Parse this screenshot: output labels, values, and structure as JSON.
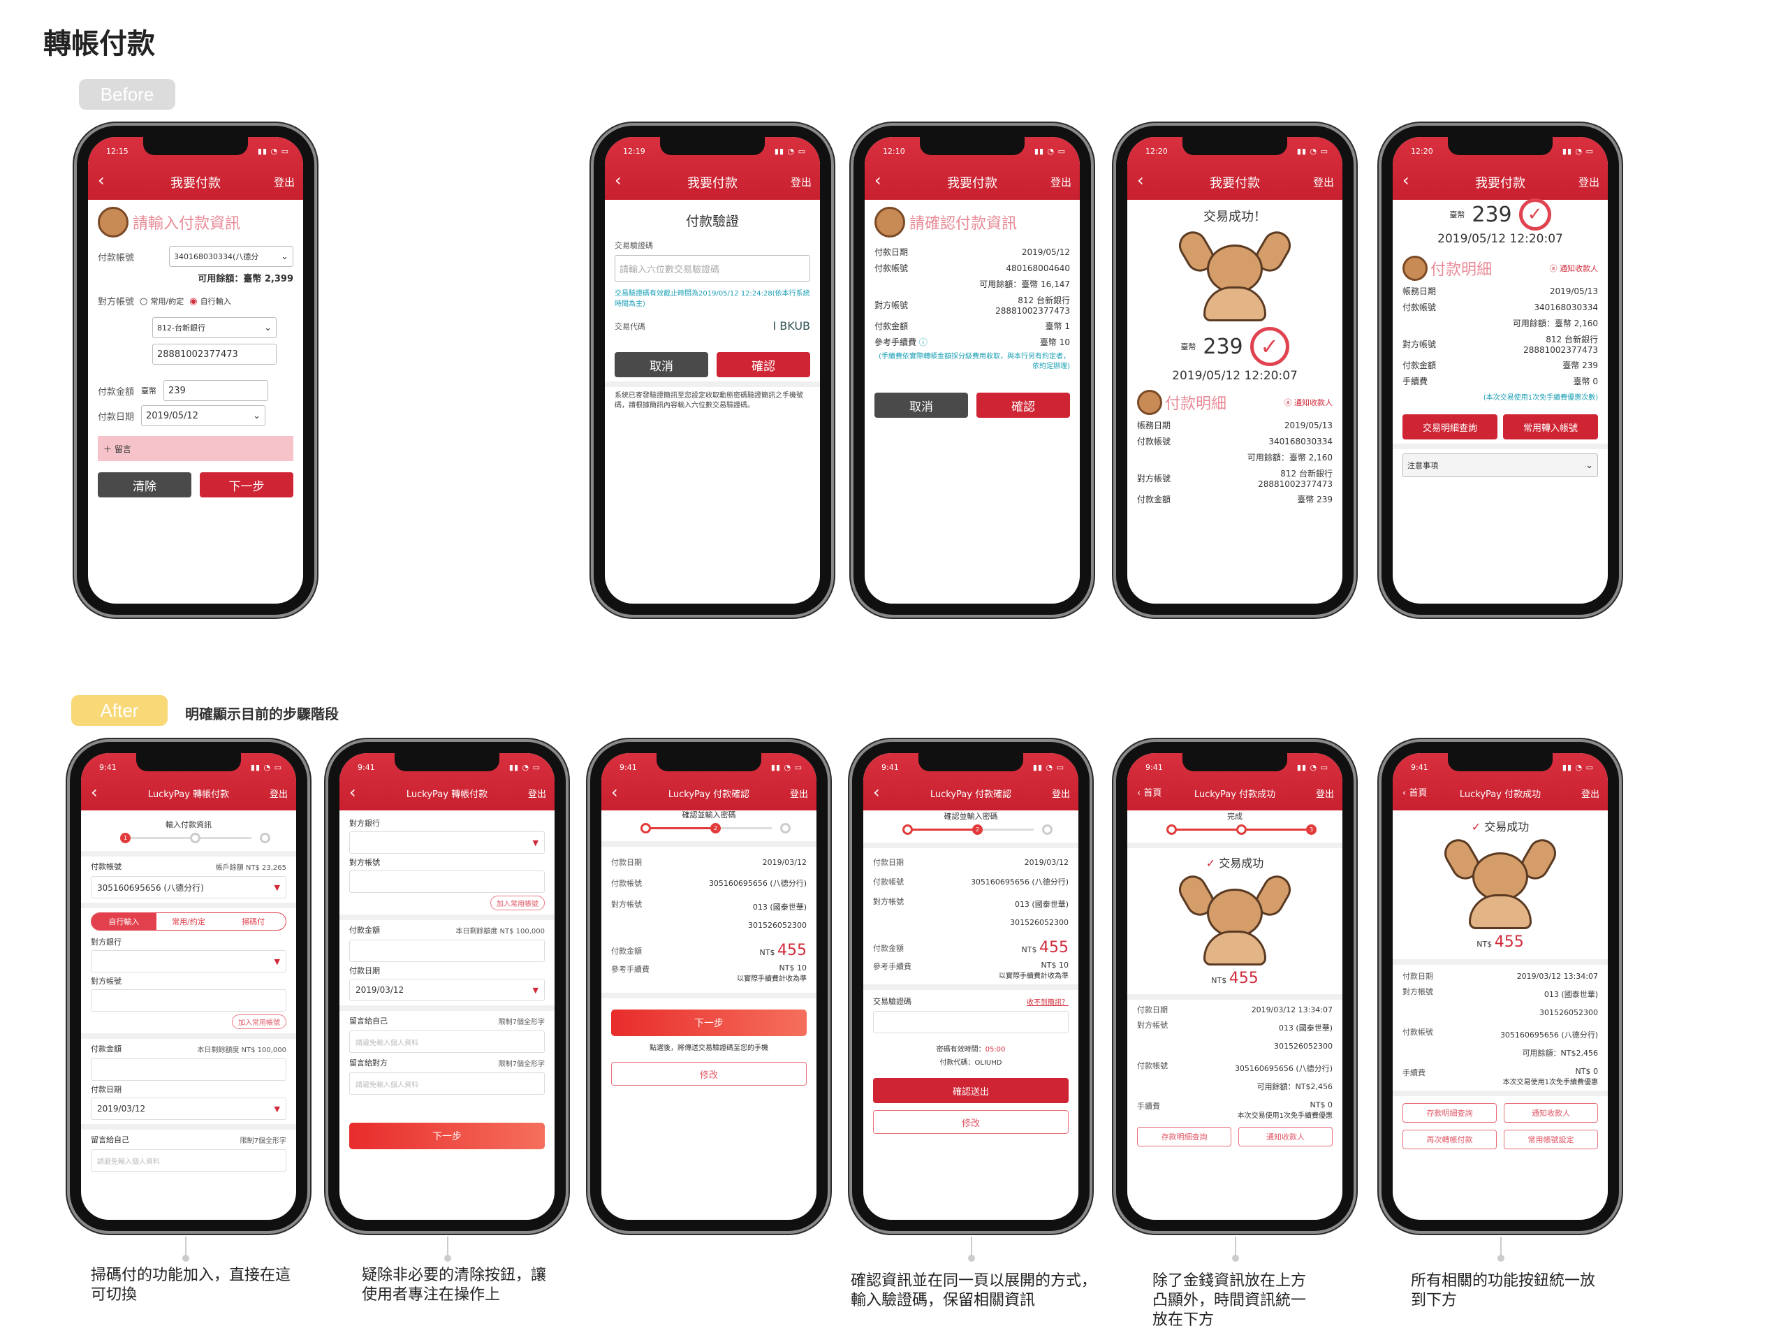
{
  "heading": "轉帳付款",
  "labels": {
    "before": "Before",
    "after": "After",
    "after_note": "明確顯示目前的步驟階段"
  },
  "before": {
    "p1": {
      "time": "12:15",
      "title": "我要付款",
      "logout": "登出",
      "prompt": "請輸入付款資訊",
      "pay_acc_label": "付款帳號",
      "pay_acc": "340168030334(八德分",
      "balance": "可用餘額：臺幣 2,399",
      "to_acc_label": "對方帳號",
      "opt1": "常用/約定",
      "opt2": "自行輸入",
      "bank": "812-台新銀行",
      "to_acc": "28881002377473",
      "amt_label": "付款金額",
      "cur": "臺幣",
      "amt": "239",
      "date_label": "付款日期",
      "date": "2019/05/12",
      "memo": "留言",
      "clear": "清除",
      "next": "下一步"
    },
    "p2": {
      "time": "12:19",
      "title": "我要付款",
      "logout": "登出",
      "heading": "付款驗證",
      "code_label": "交易驗證碼",
      "code_ph": "請輸入六位數交易驗證碼",
      "note": "交易驗證碼有效截止時間為2019/05/12 12:24:28(依本行系統時間為主)",
      "tx_label": "交易代碼",
      "tx": "I BKUB",
      "cancel": "取消",
      "confirm": "確認",
      "sms": "系統已寄發驗證簡訊至您設定收取動態密碼驗證簡訊之手機號碼，請根據簡訊內容輸入六位數交易驗證碼。"
    },
    "p3": {
      "time": "12:10",
      "title": "我要付款",
      "logout": "登出",
      "prompt": "請確認付款資訊",
      "r1l": "付款日期",
      "r1v": "2019/05/12",
      "r2l": "付款帳號",
      "r2v": "480168004640",
      "bal": "可用餘額：臺幣 16,147",
      "r3l": "對方帳號",
      "r3v1": "812 台新銀行",
      "r3v2": "28881002377473",
      "r4l": "付款金額",
      "r4v": "臺幣 1",
      "r5l": "參考手續費",
      "r5v": "臺幣 10",
      "fee_note": "(手續費依實際轉帳金額採分級費用收取，與本行另有約定者，依約定辦理)",
      "cancel": "取消",
      "confirm": "確認"
    },
    "p4": {
      "time": "12:20",
      "title": "我要付款",
      "logout": "登出",
      "success": "交易成功！",
      "cur": "臺幣",
      "amount": "239",
      "datetime": "2019/05/12 12:20:07",
      "detail": "付款明細",
      "notify": "通知收款人",
      "r1l": "帳務日期",
      "r1v": "2019/05/13",
      "r2l": "付款帳號",
      "r2v": "340168030334",
      "bal": "可用餘額：臺幣 2,160",
      "r3l": "對方帳號",
      "r3v1": "812 台新銀行",
      "r3v2": "28881002377473",
      "r4l": "付款金額",
      "r4v": "臺幣 239"
    },
    "p5": {
      "time": "12:20",
      "title": "我要付款",
      "logout": "登出",
      "cur": "臺幣",
      "amount": "239",
      "datetime": "2019/05/12 12:20:07",
      "detail": "付款明細",
      "notify": "通知收款人",
      "r1l": "帳務日期",
      "r1v": "2019/05/13",
      "r2l": "付款帳號",
      "r2v": "340168030334",
      "bal": "可用餘額：臺幣 2,160",
      "r3l": "對方帳號",
      "r3v1": "812 台新銀行",
      "r3v2": "28881002377473",
      "r4l": "付款金額",
      "r4v": "臺幣 239",
      "r5l": "手續費",
      "r5v": "臺幣 0",
      "fee_note": "(本次交易使用1次免手續費優惠次數)",
      "btn1": "交易明細查詢",
      "btn2": "常用轉入帳號",
      "notes": "注意事項"
    }
  },
  "after": {
    "a1": {
      "time": "9:41",
      "title": "LuckyPay 轉帳付款",
      "logout": "登出",
      "step": "輸入付款資訊",
      "pay_label": "付款帳號",
      "bal": "帳戶餘額 NT$ 23,265",
      "pay_acc": "305160695656 (八德分行)",
      "tab1": "自行輸入",
      "tab2": "常用/約定",
      "tab3": "掃碼付",
      "bank_label": "對方銀行",
      "acc_label": "對方帳號",
      "add": "加入常用帳號",
      "amt_label": "付款金額",
      "limit": "本日剩餘額度 NT$ 100,000",
      "date_label": "付款日期",
      "date": "2019/03/12",
      "memo_label": "留言給自己",
      "memo_limit": "限制7個全形字",
      "memo_ph": "請避免輸入個人資料"
    },
    "a2": {
      "time": "9:41",
      "title": "LuckyPay 轉帳付款",
      "logout": "登出",
      "bank_label": "對方銀行",
      "acc_label": "對方帳號",
      "add": "加入常用帳號",
      "amt_label": "付款金額",
      "limit": "本日剩餘額度 NT$ 100,000",
      "date_label": "付款日期",
      "date": "2019/03/12",
      "memo1_label": "留言給自己",
      "memo1_limit": "限制7個全形字",
      "memo1_ph": "請避免輸入個人資料",
      "memo2_label": "留言給對方",
      "memo2_limit": "限制7個全形字",
      "memo2_ph": "請避免輸入個人資料",
      "next": "下一步"
    },
    "a3": {
      "time": "9:41",
      "title": "LuckyPay 付款確認",
      "logout": "登出",
      "step": "確認並輸入密碼",
      "r1l": "付款日期",
      "r1v": "2019/03/12",
      "r2l": "付款帳號",
      "r2v": "305160695656 (八德分行)",
      "r3l": "對方帳號",
      "r3v1": "013 (國泰世華)",
      "r3v2": "301526052300",
      "r4l": "付款金額",
      "r4cur": "NT$",
      "r4v": "455",
      "r5l": "參考手續費",
      "r5v": "NT$ 10",
      "r5n": "以實際手續費計收為準",
      "next": "下一步",
      "hint": "點選後，將傳送交易驗證碼至您的手機",
      "edit": "修改"
    },
    "a4": {
      "time": "9:41",
      "title": "LuckyPay 付款確認",
      "logout": "登出",
      "step": "確認並輸入密碼",
      "r1l": "付款日期",
      "r1v": "2019/03/12",
      "r2l": "付款帳號",
      "r2v": "305160695656 (八德分行)",
      "r3l": "對方帳號",
      "r3v1": "013 (國泰世華)",
      "r3v2": "301526052300",
      "r4l": "付款金額",
      "r4cur": "NT$",
      "r4v": "455",
      "r5l": "參考手續費",
      "r5v": "NT$ 10",
      "r5n": "以實際手續費計收為準",
      "code_label": "交易驗證碼",
      "resend": "收不到簡訊？",
      "valid": "密碼有效時間：",
      "valid_time": "05:00",
      "txcode": "付款代碼：OLIUHD",
      "submit": "確認送出",
      "edit": "修改"
    },
    "a5": {
      "time": "9:41",
      "home": "首頁",
      "title": "LuckyPay 付款成功",
      "logout": "登出",
      "step": "完成",
      "success": "交易成功",
      "cur": "NT$",
      "amount": "455",
      "r1l": "付款日期",
      "r1v": "2019/03/12   13:34:07",
      "r2l": "對方帳號",
      "r2v1": "013 (國泰世華)",
      "r2v2": "301526052300",
      "r3l": "付款帳號",
      "r3v": "305160695656 (八德分行)",
      "bal": "可用餘額：NT$2,456",
      "r4l": "手續費",
      "r4v": "NT$ 0",
      "r4n": "本次交易使用1次免手續費優惠",
      "btn1": "存款明細查詢",
      "btn2": "通知收款人"
    },
    "a6": {
      "time": "9:41",
      "home": "首頁",
      "title": "LuckyPay 付款成功",
      "logout": "登出",
      "success": "交易成功",
      "cur": "NT$",
      "amount": "455",
      "r1l": "付款日期",
      "r1v": "2019/03/12   13:34:07",
      "r2l": "對方帳號",
      "r2v1": "013 (國泰世華)",
      "r2v2": "301526052300",
      "r3l": "付款帳號",
      "r3v": "305160695656 (八德分行)",
      "bal": "可用餘額：NT$2,456",
      "r4l": "手續費",
      "r4v": "NT$ 0",
      "r4n": "本次交易使用1次免手續費優惠",
      "btn1": "存款明細查詢",
      "btn2": "通知收款人",
      "btn3": "再次轉帳付款",
      "btn4": "常用帳號設定"
    }
  },
  "captions": {
    "c1": "掃碼付的功能加入，直接在這可切換",
    "c2": "疑除非必要的清除按鈕，讓使用者專注在操作上",
    "c3": "確認資訊並在同一頁以展開的方式，輸入驗證碼，保留相關資訊",
    "c4": "除了金錢資訊放在上方凸顯外，時間資訊統一放在下方",
    "c5": "所有相關的功能按鈕統一放到下方"
  },
  "colors": {
    "brand": "#cf2434",
    "pink": "#e88a96",
    "teal": "#1a9fb5"
  }
}
